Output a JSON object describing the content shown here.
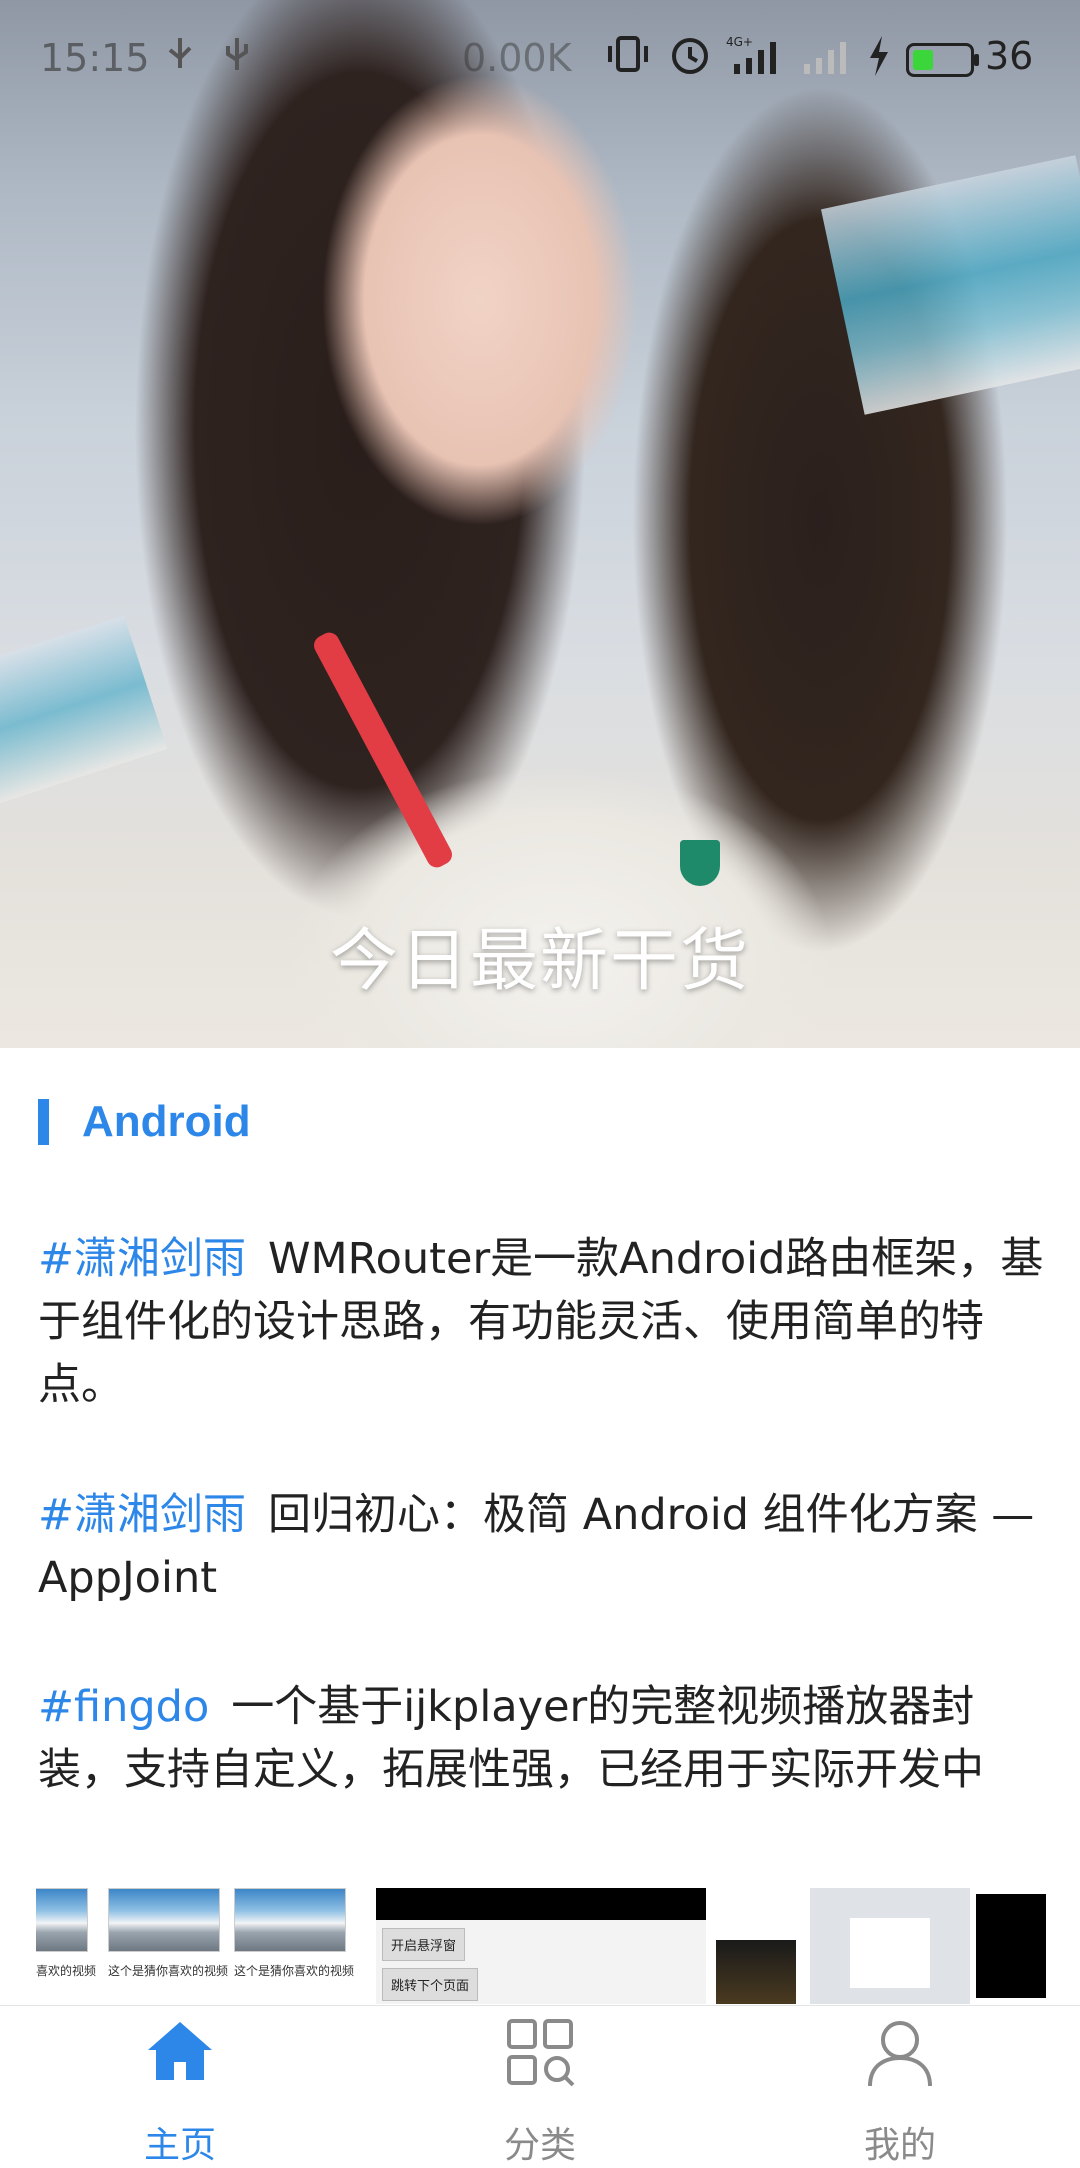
{
  "status_bar": {
    "time": "15:15",
    "speed": "0.00K",
    "battery_percent": "36",
    "battery_level": 0.36,
    "icons": [
      "usb-icon",
      "debug-icon",
      "vibrate-icon",
      "alarm-icon",
      "signal-4g-icon",
      "signal-icon",
      "charging-icon",
      "battery-icon"
    ]
  },
  "hero": {
    "title": "今日最新干货"
  },
  "section": {
    "title": "Android"
  },
  "articles": [
    {
      "author": "#潇湘剑雨",
      "text": "WMRouter是一款Android路由框架，基于组件化的设计思路，有功能灵活、使用简单的特点。"
    },
    {
      "author": "#潇湘剑雨",
      "text": "回归初心：极简 Android 组件化方案 — AppJoint"
    },
    {
      "author": "#fingdo",
      "text": "一个基于ijkplayer的完整视频播放器封装，支持自定义，拓展性强，已经用于实际开发中"
    }
  ],
  "thumbnails": {
    "captions": [
      "这个是猜你喜欢的视频",
      "这个是猜你喜欢的视频",
      "这个是猜你喜欢的视频"
    ],
    "buttons": [
      "开启悬浮窗",
      "跳转下个页面"
    ]
  },
  "nav": {
    "active_color": "#2c87e8",
    "inactive_color": "#8a8a8a",
    "items": [
      {
        "label": "主页",
        "icon": "home-icon",
        "active": true
      },
      {
        "label": "分类",
        "icon": "category-icon",
        "active": false
      },
      {
        "label": "我的",
        "icon": "profile-icon",
        "active": false
      }
    ]
  }
}
